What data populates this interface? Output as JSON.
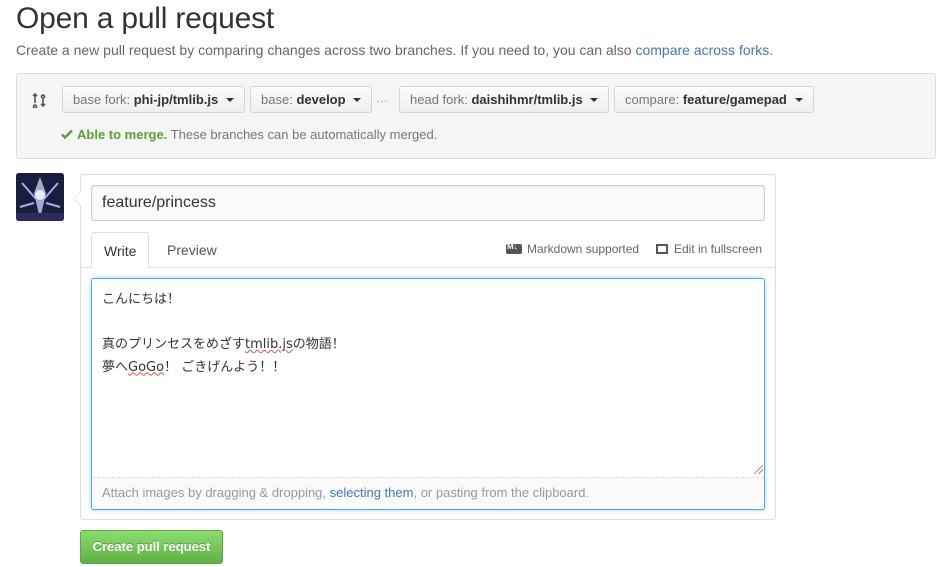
{
  "page": {
    "title": "Open a pull request",
    "description": "Create a new pull request by comparing changes across two branches. If you need to, you can also ",
    "compare_forks_link": "compare across forks",
    "description_end": "."
  },
  "range": {
    "base_fork_label": "base fork:",
    "base_fork_value": "phi-jp/tmlib.js",
    "base_label": "base:",
    "base_value": "develop",
    "dots": "…",
    "head_fork_label": "head fork:",
    "head_fork_value": "daishihmr/tmlib.js",
    "compare_label": "compare:",
    "compare_value": "feature/gamepad",
    "merge_ok": "Able to merge.",
    "merge_text": "These branches can be automatically merged."
  },
  "form": {
    "title_value": "feature/princess",
    "tab_write": "Write",
    "tab_preview": "Preview",
    "markdown_supported": "Markdown supported",
    "edit_fullscreen": "Edit in fullscreen",
    "body_line1": "こんにちは！",
    "body_line2": "",
    "body_line3_a": "真のプリンセスをめざす",
    "body_line3_b": "tmlib.js",
    "body_line3_c": "の物語！",
    "body_line4_a": "夢へ",
    "body_line4_b": "GoGo",
    "body_line4_c": "！ ごきげんよう！！",
    "attach_pre": "Attach images by dragging & dropping, ",
    "attach_link": "selecting them",
    "attach_post": ", or pasting from the clipboard.",
    "submit_label": "Create pull request"
  },
  "colors": {
    "link": "#4078c0",
    "success": "#55a532",
    "submit": "#6cc644",
    "focus": "#51a7e8"
  }
}
